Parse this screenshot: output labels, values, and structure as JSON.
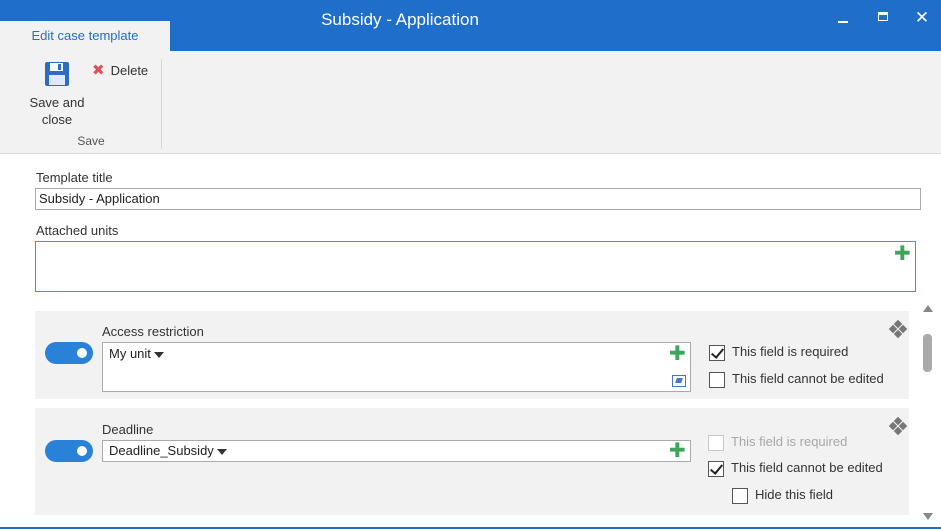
{
  "window": {
    "title": "Subsidy - Application",
    "active_tab": "Edit case template",
    "controls": {
      "minimize": "minimize-icon",
      "maximize": "maximize-icon",
      "close": "close-icon"
    }
  },
  "ribbon": {
    "save_close_line1": "Save and",
    "save_close_line2": "close",
    "delete_label": "Delete",
    "group_label": "Save",
    "icons": {
      "save": "floppy-disk-icon",
      "delete": "red-x-icon"
    }
  },
  "form": {
    "template_title_label": "Template title",
    "template_title_value": "Subsidy - Application",
    "attached_units_label": "Attached units"
  },
  "fields": [
    {
      "title": "Access restriction",
      "enabled": true,
      "value": "My unit",
      "options": [
        {
          "label": "This field is required",
          "checked": true,
          "disabled": false
        },
        {
          "label": "This field cannot be edited",
          "checked": false,
          "disabled": false
        }
      ]
    },
    {
      "title": "Deadline",
      "enabled": true,
      "value": "Deadline_Subsidy",
      "options": [
        {
          "label": "This field is required",
          "checked": false,
          "disabled": true
        },
        {
          "label": "This field cannot be edited",
          "checked": true,
          "disabled": false
        },
        {
          "label": "Hide this field",
          "checked": false,
          "disabled": false
        }
      ]
    }
  ],
  "colors": {
    "titlebar": "#1f6ec9",
    "toggle_on": "#2a82d8",
    "add_icon": "#3ea55a",
    "delete_icon": "#e0525b"
  }
}
